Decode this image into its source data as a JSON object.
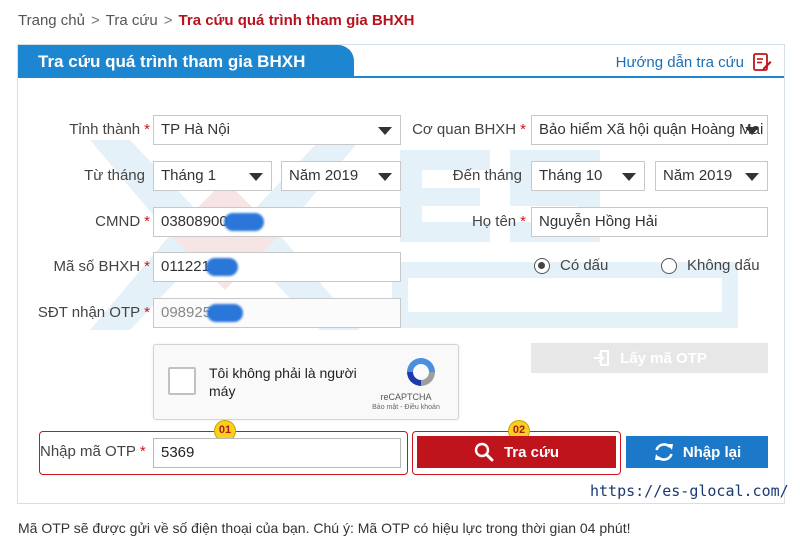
{
  "breadcrumb": {
    "home": "Trang chủ",
    "sep1": ">",
    "section": "Tra cứu",
    "sep2": ">",
    "current": "Tra cứu quá trình tham gia BHXH"
  },
  "panel": {
    "title": "Tra cứu quá trình tham gia BHXH",
    "guide_link": "Hướng dẫn tra cứu"
  },
  "form": {
    "province": {
      "label": "Tỉnh thành",
      "value": "TP Hà Nội"
    },
    "agency": {
      "label": "Cơ quan BHXH",
      "value": "Bảo hiểm Xã hội quận Hoàng Mai"
    },
    "from": {
      "label": "Từ tháng",
      "month": "Tháng 1",
      "year": "Năm 2019"
    },
    "to": {
      "label": "Đến tháng",
      "month": "Tháng 10",
      "year": "Năm 2019"
    },
    "id_card": {
      "label": "CMND",
      "value": "03808900"
    },
    "full_name": {
      "label": "Họ tên",
      "value": "Nguyễn Hồng Hải"
    },
    "insurance_code": {
      "label": "Mã số BHXH",
      "value": "011221"
    },
    "phone": {
      "label": "SĐT nhận OTP",
      "value": "098925"
    },
    "accent_options": {
      "with": "Có dấu",
      "without": "Không dấu",
      "selected": "with"
    },
    "required_mark": "*"
  },
  "captcha": {
    "text": "Tôi không phải là người máy",
    "brand": "reCAPTCHA",
    "links": "Bảo mật - Điều khoản"
  },
  "otp": {
    "get_button": "Lấy mã OTP",
    "label": "Nhập mã OTP",
    "value": "5369",
    "badge": "01"
  },
  "actions": {
    "search": "Tra cứu",
    "search_badge": "02",
    "reset": "Nhập lại"
  },
  "watermark": {
    "site_url": "https://es-glocal.com/"
  },
  "footer_note": "Mã OTP sẽ được gửi về số điện thoại của bạn. Chú ý: Mã OTP có hiệu lực trong thời gian 04 phút!",
  "colors": {
    "accent_blue": "#1c86d0",
    "accent_red": "#c0141c",
    "badge_yellow": "#f5d21d"
  }
}
